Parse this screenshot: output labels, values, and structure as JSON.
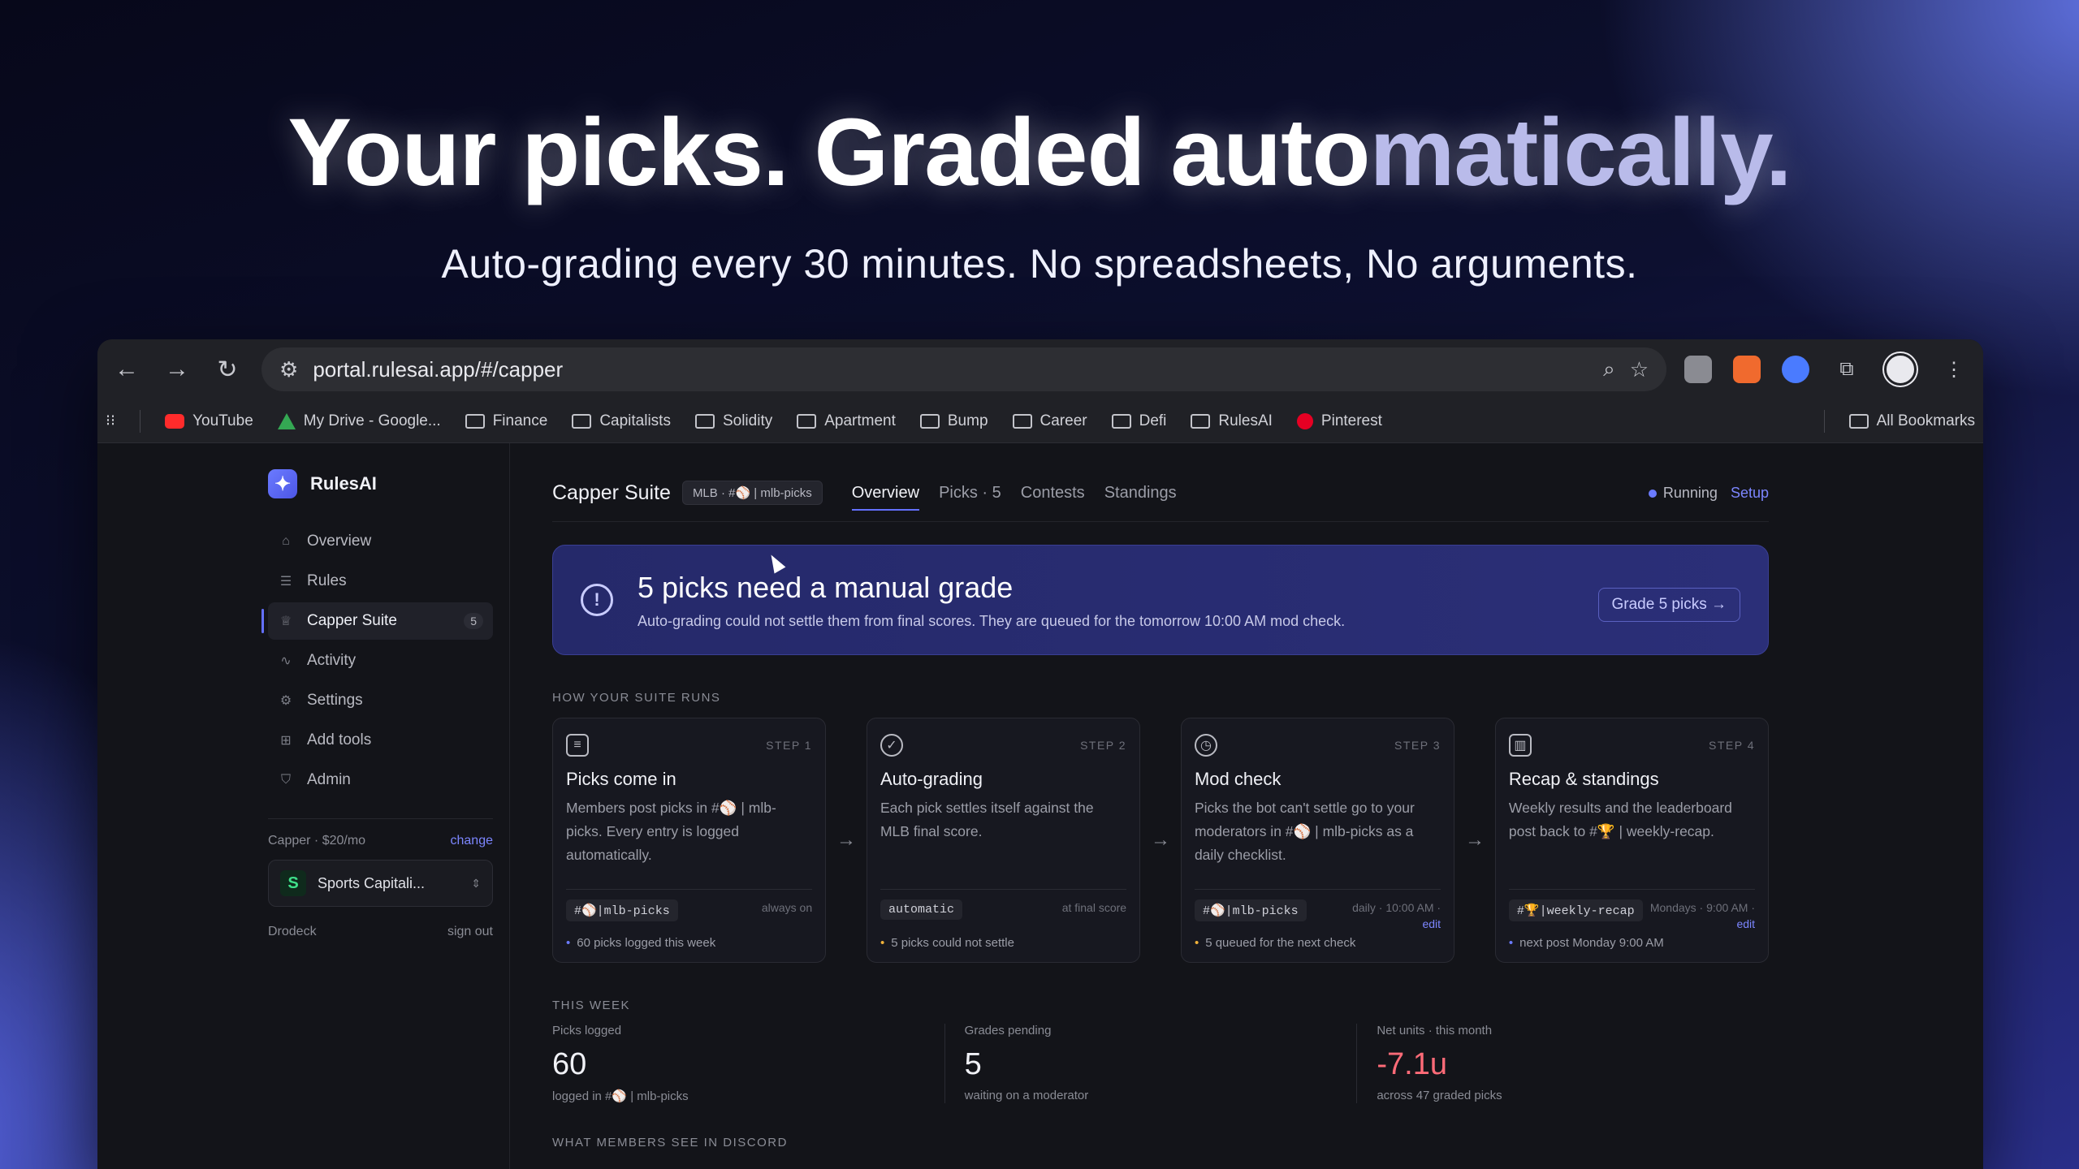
{
  "hero": {
    "title_main": "Your picks. Graded auto",
    "title_fade": "matically.",
    "subtitle": "Auto-grading every 30 minutes. No spreadsheets, No arguments."
  },
  "browser": {
    "url": "portal.rulesai.app/#/capper",
    "bookmarks": [
      "YouTube",
      "My Drive - Google...",
      "Finance",
      "Capitalists",
      "Solidity",
      "Apartment",
      "Bump",
      "Career",
      "Defi",
      "RulesAI",
      "Pinterest"
    ],
    "all_bookmarks": "All Bookmarks"
  },
  "sidebar": {
    "brand": "RulesAI",
    "items": [
      {
        "label": "Overview",
        "icon": "home-icon"
      },
      {
        "label": "Rules",
        "icon": "list-icon"
      },
      {
        "label": "Capper Suite",
        "icon": "trophy-icon",
        "badge": "5"
      },
      {
        "label": "Activity",
        "icon": "activity-icon"
      },
      {
        "label": "Settings",
        "icon": "gear-icon"
      },
      {
        "label": "Add tools",
        "icon": "plus-square-icon"
      },
      {
        "label": "Admin",
        "icon": "shield-icon"
      }
    ],
    "plan": "Capper · $20/mo",
    "change": "change",
    "workspace": "Sports Capitali...",
    "user": "Drodeck",
    "sign_out": "sign out"
  },
  "header": {
    "title": "Capper Suite",
    "channel_chip": "MLB · #⚾ | mlb-picks",
    "tabs": [
      "Overview",
      "Picks · 5",
      "Contests",
      "Standings"
    ],
    "status": "Running",
    "setup": "Setup"
  },
  "alert": {
    "title": "5 picks need a manual grade",
    "desc": "Auto-grading could not settle them from final scores. They are queued for the tomorrow 10:00 AM mod check.",
    "button": "Grade 5 picks →"
  },
  "how_label": "HOW YOUR SUITE RUNS",
  "steps": [
    {
      "num": "STEP 1",
      "title": "Picks come in",
      "desc": "Members post picks in #⚾ | mlb-picks. Every entry is logged automatically.",
      "tag": "#⚾|mlb-picks",
      "meta": "always on",
      "meta2": "",
      "note": "60 picks logged this week"
    },
    {
      "num": "STEP 2",
      "title": "Auto-grading",
      "desc": "Each pick settles itself against the MLB final score.",
      "tag": "automatic",
      "meta": "at final score",
      "meta2": "",
      "note": "5 picks could not settle"
    },
    {
      "num": "STEP 3",
      "title": "Mod check",
      "desc": "Picks the bot can't settle go to your moderators in #⚾ | mlb-picks as a daily checklist.",
      "tag": "#⚾|mlb-picks",
      "meta": "daily · 10:00 AM ·",
      "meta2": "edit",
      "note": "5 queued for the next check"
    },
    {
      "num": "STEP 4",
      "title": "Recap & standings",
      "desc": "Weekly results and the leaderboard post back to #🏆 | weekly-recap.",
      "tag": "#🏆|weekly-recap",
      "meta": "Mondays · 9:00 AM ·",
      "meta2": "edit",
      "note": "next post Monday 9:00 AM"
    }
  ],
  "week_label": "THIS WEEK",
  "stats": [
    {
      "label": "Picks logged",
      "value": "60",
      "sub": "logged in #⚾ | mlb-picks"
    },
    {
      "label": "Grades pending",
      "value": "5",
      "sub": "waiting on a moderator"
    },
    {
      "label": "Net units · this month",
      "value": "-7.1u",
      "sub": "across 47 graded picks"
    }
  ],
  "discord_label": "WHAT MEMBERS SEE IN DISCORD"
}
